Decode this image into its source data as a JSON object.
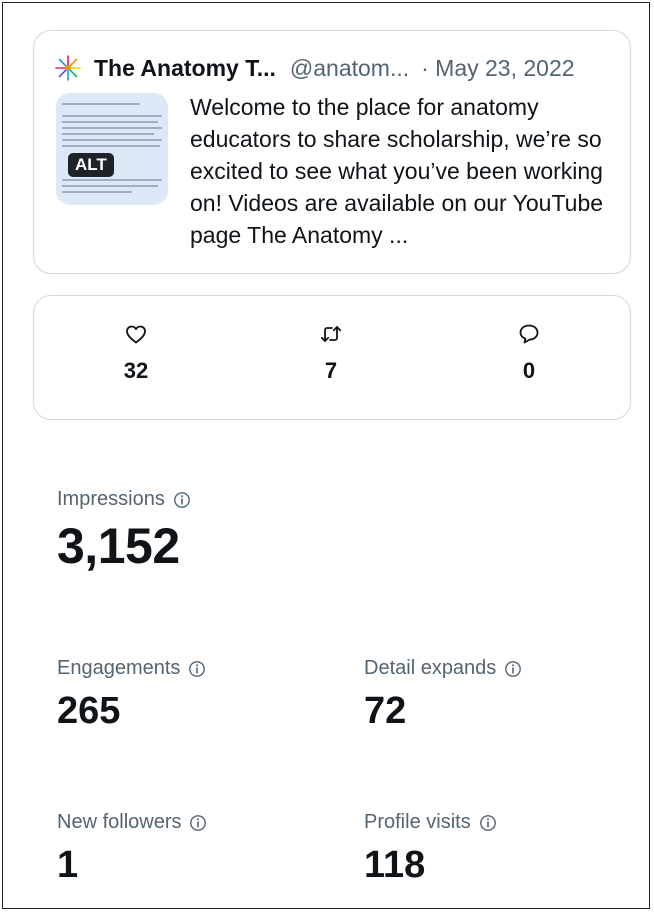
{
  "tweet": {
    "author_name": "The Anatomy T...",
    "author_handle": "@anatom...",
    "date": "· May 23, 2022",
    "image_badge": "ALT",
    "text": "Welcome to the place for anatomy educators to share scholarship, we’re so excited to see what you’ve been working on! Videos are available on our YouTube page The Anatomy ..."
  },
  "engagement": {
    "likes": "32",
    "retweets": "7",
    "replies": "0"
  },
  "metrics": {
    "impressions": {
      "label": "Impressions",
      "value": "3,152"
    },
    "engagements": {
      "label": "Engagements",
      "value": "265"
    },
    "detail_expands": {
      "label": "Detail expands",
      "value": "72"
    },
    "new_followers": {
      "label": "New followers",
      "value": "1"
    },
    "profile_visits": {
      "label": "Profile visits",
      "value": "118"
    }
  },
  "icons": {
    "avatar": "sparkle-avatar-icon",
    "like": "heart-icon",
    "retweet": "retweet-icon",
    "reply": "reply-bubble-icon",
    "info": "info-icon"
  },
  "colors": {
    "text_primary": "#0f1419",
    "text_secondary": "#536471",
    "border": "#cfd9de"
  }
}
